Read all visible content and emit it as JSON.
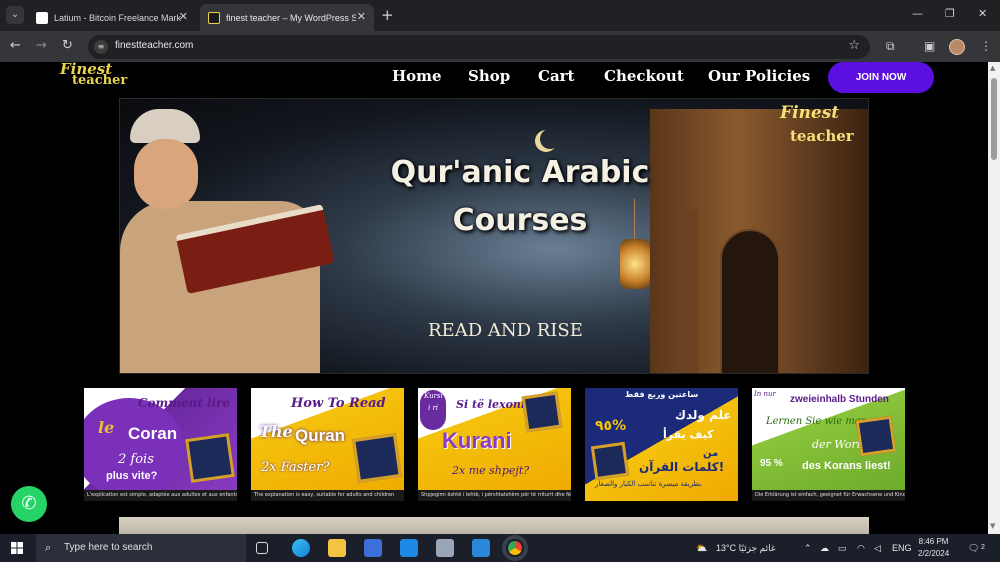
{
  "browser": {
    "tabs": [
      {
        "title": "Latium - Bitcoin Freelance Mark",
        "active": false
      },
      {
        "title": "finest teacher – My WordPress S",
        "active": true
      }
    ],
    "url": "finestteacher.com"
  },
  "site": {
    "logo_line1": "Finest",
    "logo_line2": "teacher",
    "nav": [
      "Home",
      "Shop",
      "Cart",
      "Checkout",
      "Our Policies"
    ],
    "join_label": "JOIN NOW"
  },
  "hero": {
    "title_line1": "Qur'anic Arabic",
    "title_line2": "Courses",
    "tagline": "READ AND RISE",
    "logo_line1": "Finest",
    "logo_line2": "teacher"
  },
  "cards": [
    {
      "name": "card-french",
      "lines": [
        "Comment lire",
        "le",
        "Coran",
        "2 fois",
        "plus vite?"
      ],
      "footer": "L'explication est simple, adaptée aux adultes et aux enfants"
    },
    {
      "name": "card-english",
      "lines": [
        "How To Read",
        "The",
        "Quran",
        "2x Faster?"
      ],
      "footer": "The explanation is easy, suitable for adults and children"
    },
    {
      "name": "card-albanian",
      "lines": [
        "Kursi",
        "i ri",
        "Si të lexoni",
        "Kurani",
        "2x me shpejt?"
      ],
      "footer": "Shpjegimi është i lehtë, i përshtatshëm për të rriturit dhe fëmijët"
    },
    {
      "name": "card-arabic",
      "lines": [
        "ساعتين وربع فقط",
        "٩٥%",
        "علم ولدك",
        "كيف يقرأ",
        "من",
        "كلمات القرآن!",
        "بطريقة ميسرة تناسب الكبار والصغار"
      ],
      "footer": ""
    },
    {
      "name": "card-german",
      "lines": [
        "In nur",
        "zweieinhalb Stunden",
        "Lernen Sie wie man",
        "der Worte",
        "95 %",
        "des Korans liest!"
      ],
      "footer": "Die Erklärung ist einfach, geeignet für Erwachsene und Kinder"
    }
  ],
  "taskbar": {
    "search_placeholder": "Type here to search",
    "weather": "13°C  غائم جزئيًا",
    "lang": "ENG",
    "time": "8:46 PM",
    "date": "2/2/2024",
    "notifications": "2"
  }
}
